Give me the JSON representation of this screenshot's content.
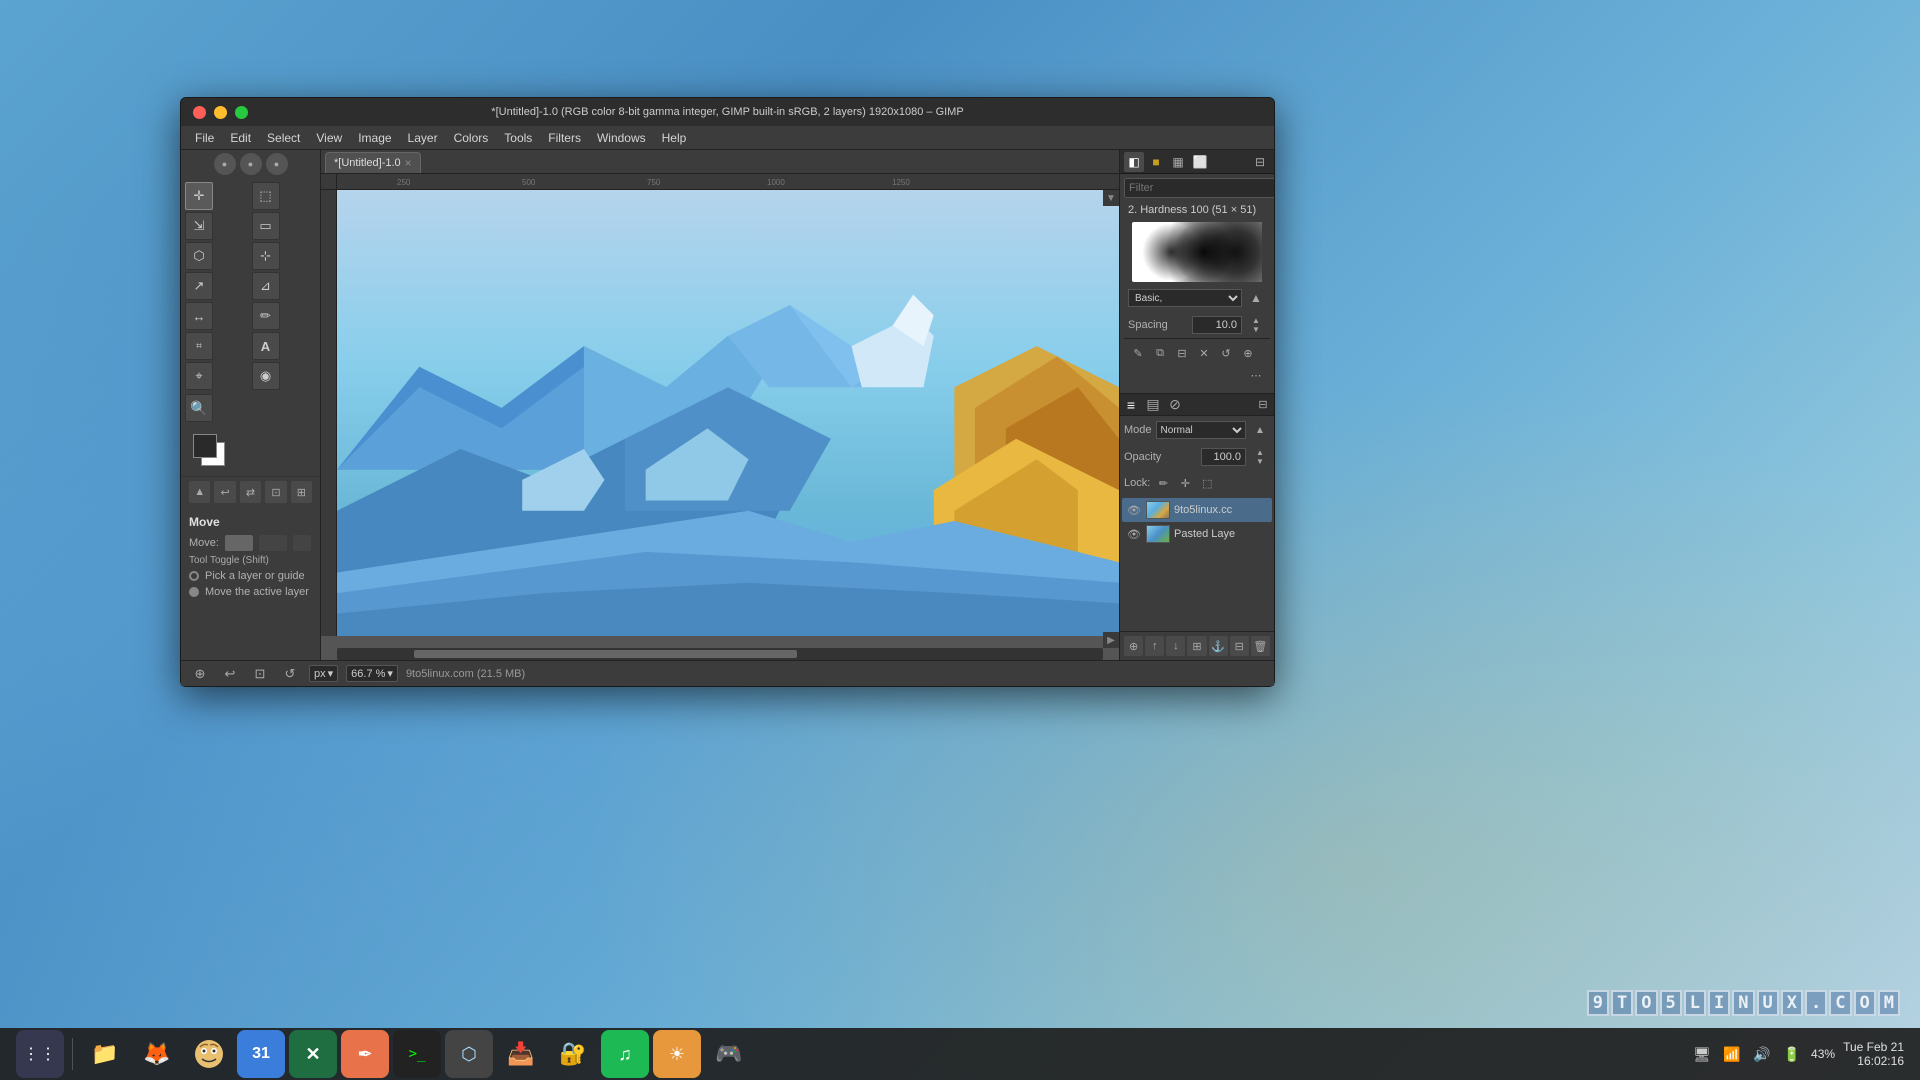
{
  "window": {
    "title": "*[Untitled]-1.0 (RGB color 8-bit gamma integer, GIMP built-in sRGB, 2 layers) 1920x1080 – GIMP",
    "close_btn": "×",
    "min_btn": "−",
    "max_btn": "+"
  },
  "menu": {
    "items": [
      "File",
      "Edit",
      "Select",
      "View",
      "Image",
      "Layer",
      "Colors",
      "Tools",
      "Filters",
      "Windows",
      "Help"
    ]
  },
  "tools": {
    "list": [
      {
        "icon": "✛",
        "name": "move-tool"
      },
      {
        "icon": "⬚",
        "name": "align-tool"
      },
      {
        "icon": "⇲",
        "name": "scale-tool"
      },
      {
        "icon": "▭",
        "name": "rect-select"
      },
      {
        "icon": "⬡",
        "name": "lasso-tool"
      },
      {
        "icon": "⊹",
        "name": "fuzzy-select"
      },
      {
        "icon": "↗",
        "name": "transform-tool"
      },
      {
        "icon": "⊿",
        "name": "shear-tool"
      },
      {
        "icon": "↔",
        "name": "flip-tool"
      },
      {
        "icon": "✏",
        "name": "pencil-tool"
      },
      {
        "icon": "A",
        "name": "text-tool"
      },
      {
        "icon": "⌗",
        "name": "heal-tool"
      },
      {
        "icon": "🔍",
        "name": "zoom-tool"
      },
      {
        "icon": "⌖",
        "name": "clone-tool"
      },
      {
        "icon": "⌒",
        "name": "smudge-tool"
      },
      {
        "icon": "◉",
        "name": "dodge-tool"
      }
    ],
    "active": "move-tool"
  },
  "tool_options": {
    "title": "Move",
    "move_label": "Move:",
    "pick_layer": "Pick a layer or guide",
    "move_active": "Move the active layer"
  },
  "brush_panel": {
    "filter_placeholder": "Filter",
    "brush_name": "2. Hardness 100 (51 × 51)",
    "brush_type": "Basic,",
    "spacing_label": "Spacing",
    "spacing_value": "10.0"
  },
  "layer_panel": {
    "mode_label": "Mode",
    "mode_value": "Normal",
    "opacity_label": "Opacity",
    "opacity_value": "100.0",
    "lock_label": "Lock:",
    "layers": [
      {
        "name": "9to5linux.cc",
        "visible": true,
        "active": true
      },
      {
        "name": "Pasted Laye",
        "visible": true,
        "active": false
      }
    ]
  },
  "canvas": {
    "tab_name": "*[Untitled]-1.0",
    "ruler_labels": [
      "250",
      "500",
      "750",
      "1000",
      "1250"
    ],
    "zoom": "66.7 %",
    "unit": "px",
    "info": "9to5linux.com (21.5 MB)"
  },
  "taskbar": {
    "apps": [
      {
        "name": "grid-menu",
        "icon": "⋮⋮",
        "color": "#444466"
      },
      {
        "name": "files",
        "icon": "📁",
        "color": "#f5a623"
      },
      {
        "name": "firefox",
        "icon": "🦊",
        "color": "transparent"
      },
      {
        "name": "gimp-face",
        "icon": "👾",
        "color": "transparent"
      },
      {
        "name": "calendar",
        "icon": "31",
        "color": "#3b7ddb"
      },
      {
        "name": "excel",
        "icon": "X",
        "color": "#1e6e42"
      },
      {
        "name": "editor",
        "icon": "✒",
        "color": "#e8734a"
      },
      {
        "name": "terminal",
        "icon": ">_",
        "color": "#333"
      },
      {
        "name": "vm",
        "icon": "⬡",
        "color": "#555"
      },
      {
        "name": "download",
        "icon": "⬇",
        "color": "#3a7bc8"
      },
      {
        "name": "security",
        "icon": "⊛",
        "color": "#d4a020"
      },
      {
        "name": "spotify",
        "icon": "♫",
        "color": "#1db954"
      },
      {
        "name": "settings",
        "icon": "☀",
        "color": "#e8983c"
      },
      {
        "name": "steam",
        "icon": "◎",
        "color": "#aaa"
      }
    ],
    "system": {
      "datetime": "Tue Feb 21  16:02:16",
      "date_label": "Tue Feb 21",
      "time_label": "16:02:16",
      "battery": "43%"
    }
  },
  "watermark": {
    "text": "9TO5LINUX.COM",
    "letters": [
      "9",
      "T",
      "O",
      "5",
      "L",
      "I",
      "N",
      "U",
      "X",
      ".",
      "C",
      "O",
      "M"
    ]
  }
}
